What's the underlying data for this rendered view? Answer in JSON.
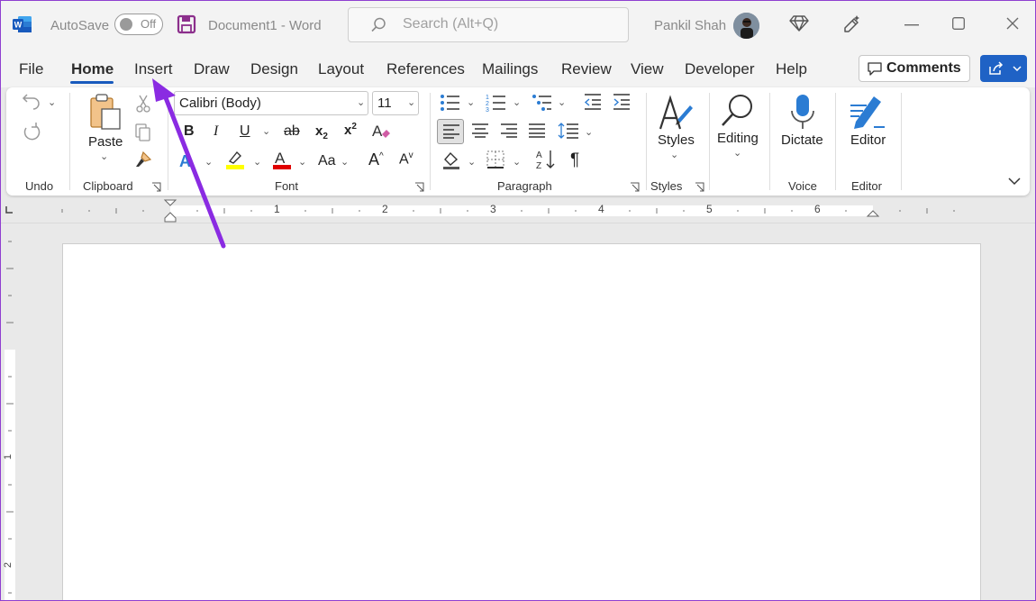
{
  "titlebar": {
    "autosave_label": "AutoSave",
    "autosave_state": "Off",
    "document_title": "Document1  -  Word",
    "search_placeholder": "Search (Alt+Q)",
    "user_name": "Pankil Shah"
  },
  "menu": {
    "tabs": [
      "File",
      "Home",
      "Insert",
      "Draw",
      "Design",
      "Layout",
      "References",
      "Mailings",
      "Review",
      "View",
      "Developer",
      "Help"
    ],
    "active_tab": "Home",
    "comments_label": "Comments"
  },
  "ribbon": {
    "groups": {
      "undo": "Undo",
      "clipboard": "Clipboard",
      "font": "Font",
      "paragraph": "Paragraph",
      "styles": "Styles",
      "voice": "Voice",
      "editor": "Editor"
    },
    "paste_label": "Paste",
    "font_name": "Calibri (Body)",
    "font_size": "11",
    "styles_label": "Styles",
    "editing_label": "Editing",
    "dictate_label": "Dictate",
    "editor_label": "Editor",
    "change_case_label": "Aa"
  },
  "ruler": {
    "horizontal_marks": [
      "1",
      "2",
      "3",
      "4",
      "5",
      "6"
    ],
    "vertical_marks": [
      "1",
      "2"
    ]
  },
  "colors": {
    "accent_blue": "#185abd",
    "share_button": "#1f62c5",
    "highlight_yellow": "#ffff00",
    "font_color_red": "#e00000",
    "annotation_arrow": "#8a2be2",
    "word_logo": "#185abd"
  }
}
